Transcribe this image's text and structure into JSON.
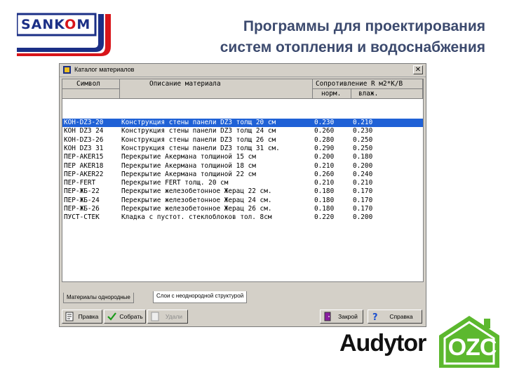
{
  "brand": {
    "logo_text_a": "SANK",
    "logo_text_b": "O",
    "logo_text_c": "M",
    "colors": {
      "navy": "#1b2f86",
      "red": "#d8151a"
    }
  },
  "slide": {
    "title_line1": "Программы для проектирования",
    "title_line2": "систем отопления и водоснабжения"
  },
  "window": {
    "title": "Каталог материалов",
    "close_glyph": "✕"
  },
  "table": {
    "headers": {
      "symbol": "Символ",
      "description": "Описание материала",
      "resistance": "Сопротивление R м2*K/B",
      "norm": "норм.",
      "wet": "влаж."
    },
    "selected_index": 0,
    "rows": [
      {
        "symbol": "КОН-DZ3-20",
        "description": "Конструкция стены панели DZ3 толщ 20 см",
        "norm": "0.230",
        "wet": "0.210"
      },
      {
        "symbol": "КОН DZ3 24",
        "description": "Конструкция стены панели DZ3 толщ 24 см",
        "norm": "0.260",
        "wet": "0.230"
      },
      {
        "symbol": "КОН-DZ3-26",
        "description": "Конструкция стены панели DZ3 толщ 26 см",
        "norm": "0.280",
        "wet": "0.250"
      },
      {
        "symbol": "КОН DZ3 31",
        "description": "Конструкция стены панели DZ3 толщ 31 см.",
        "norm": "0.290",
        "wet": "0.250"
      },
      {
        "symbol": "ПЕР-AKER15",
        "description": "Перекрытие Акермана толщиной 15 см",
        "norm": "0.200",
        "wet": "0.180"
      },
      {
        "symbol": "ПЕР AKER18",
        "description": "Перекрытие Акермана толщиной 18 см",
        "norm": "0.210",
        "wet": "0.200"
      },
      {
        "symbol": "ПЕР-AKER22",
        "description": "Перекрытие Акермана толщиной 22 см",
        "norm": "0.260",
        "wet": "0.240"
      },
      {
        "symbol": "ПЕР-FERT",
        "description": "Перекрытие FERT толщ. 20 см",
        "norm": "0.210",
        "wet": "0.210"
      },
      {
        "symbol": "ПЕР-ЖБ-22",
        "description": "Перекрытие железобетонное Жерац 22 см.",
        "norm": "0.180",
        "wet": "0.170"
      },
      {
        "symbol": "ПЕР-ЖБ-24",
        "description": "Перекрытие железобетонное Жерац 24 см.",
        "norm": "0.180",
        "wet": "0.170"
      },
      {
        "symbol": "ПЕР-ЖБ-26",
        "description": "Перекрытие железобетонное Жерац 26 см.",
        "norm": "0.180",
        "wet": "0.170"
      },
      {
        "symbol": "ПУСТ-СТЕК",
        "description": "Кладка с пустот. стеклоблоков тол. 8см",
        "norm": "0.220",
        "wet": "0.200"
      }
    ]
  },
  "tabs": [
    {
      "label": "Материалы однородные",
      "active": false
    },
    {
      "label": "Слои с неоднородной структурой",
      "active": true
    }
  ],
  "buttons": {
    "edit": "Правка",
    "select": "Собрать",
    "delete": "Удали",
    "close": "Закрой",
    "help": "Справка"
  },
  "footer_logo": {
    "word": "Audytor",
    "badge": "OZC",
    "badge_color": "#5cb82e"
  }
}
